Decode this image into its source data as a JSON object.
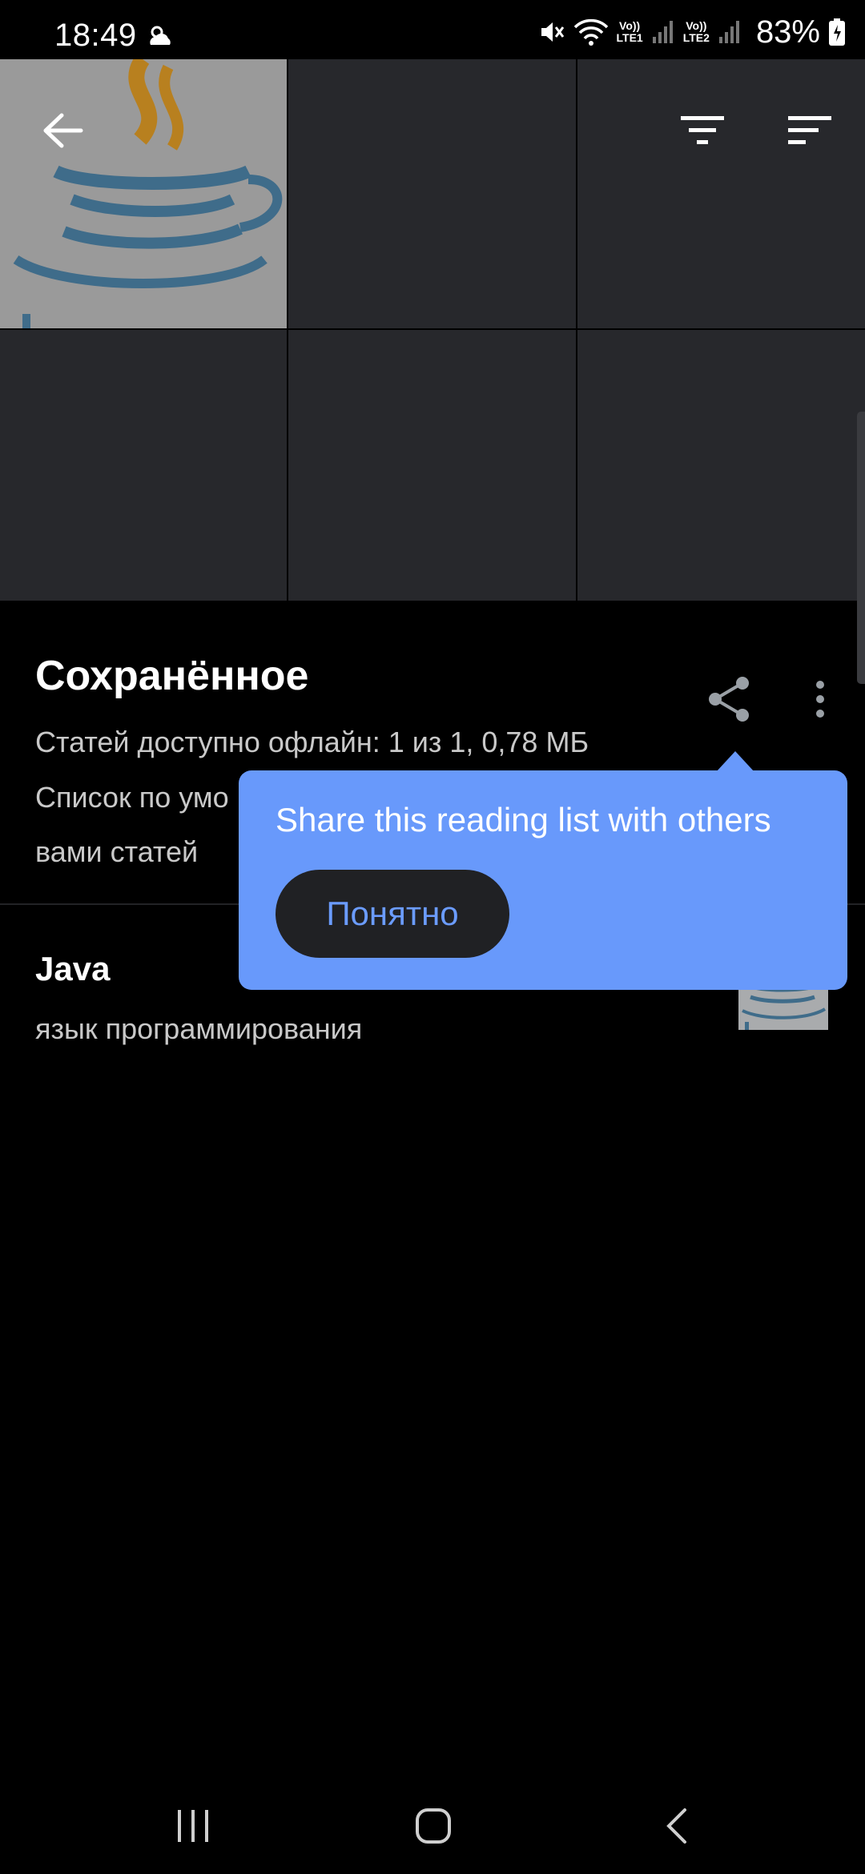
{
  "status_bar": {
    "time": "18:49",
    "network1": {
      "top": "Vo))",
      "bottom": "LTE1"
    },
    "network2": {
      "top": "Vo))",
      "bottom": "LTE2"
    },
    "battery": "83%"
  },
  "icons": {
    "back": "arrow-left",
    "filter": "filter-funnel",
    "sort": "sort-lines",
    "share": "share-nodes",
    "more": "vertical-dots"
  },
  "reading_list": {
    "title": "Сохранённое",
    "offline_info": "Статей доступно офлайн: 1 из 1, 0,78 МБ",
    "description_line1": "Список по умо",
    "description_line2": "вами статей"
  },
  "articles": [
    {
      "title": "Java",
      "subtitle": "язык программирования"
    }
  ],
  "tooltip": {
    "text": "Share this reading list with others",
    "button_label": "Понятно"
  },
  "colors": {
    "accent": "#6899fb",
    "background": "#000000",
    "tile": "#27282c"
  }
}
